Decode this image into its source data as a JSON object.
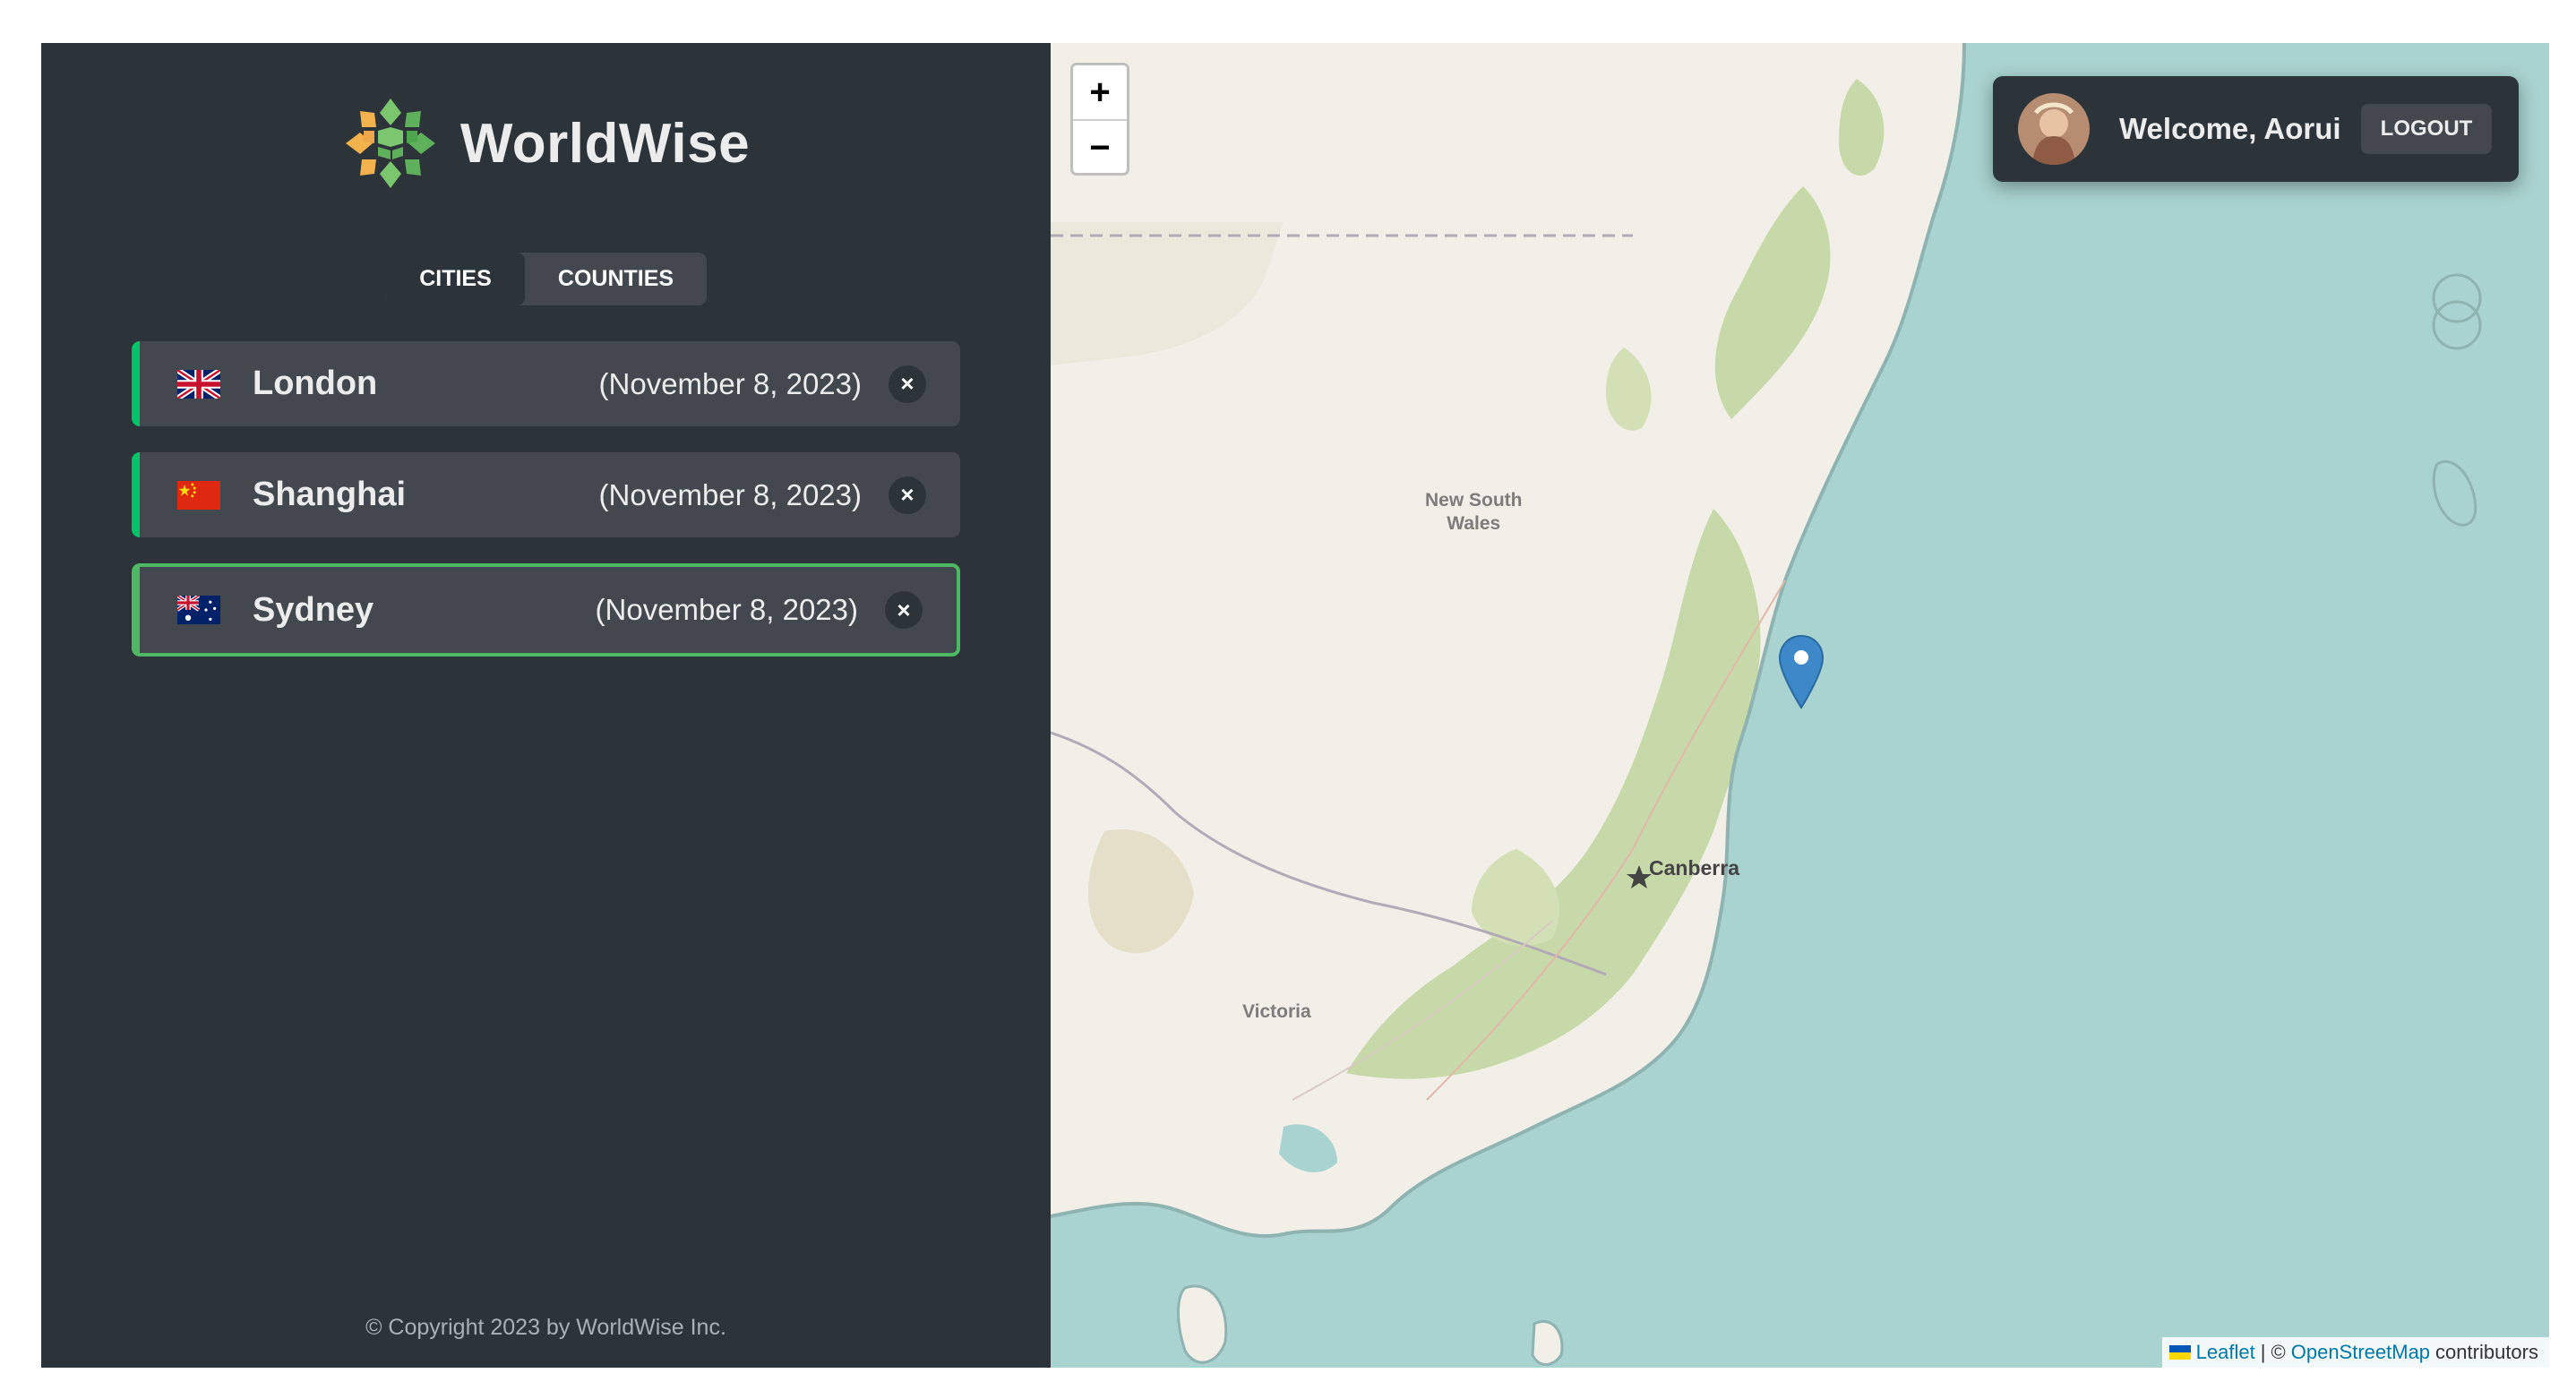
{
  "app": {
    "name": "WorldWise"
  },
  "tabs": [
    {
      "label": "CITIES",
      "active": true
    },
    {
      "label": "COUNTIES",
      "active": false
    }
  ],
  "cities": [
    {
      "name": "London",
      "date": "(November 8, 2023)",
      "flag": "uk-flag",
      "selected": false
    },
    {
      "name": "Shanghai",
      "date": "(November 8, 2023)",
      "flag": "china-flag",
      "selected": false
    },
    {
      "name": "Sydney",
      "date": "(November 8, 2023)",
      "flag": "australia-flag",
      "selected": true
    }
  ],
  "delete_label": "×",
  "footer": "© Copyright 2023 by WorldWise Inc.",
  "map": {
    "zoom_in": "+",
    "zoom_out": "−",
    "labels": {
      "nsw": "New South\nWales",
      "canberra": "Canberra",
      "victoria": "Victoria"
    },
    "attribution": {
      "leaflet": "Leaflet",
      "separator": "| ©",
      "osm": "OpenStreetMap",
      "contributors": "contributors"
    }
  },
  "user": {
    "welcome": "Welcome, Aorui",
    "logout": "LOGOUT"
  },
  "colors": {
    "sidebar_bg": "#2d3439",
    "item_bg": "#42484d",
    "accent_green": "#00c46a",
    "selected_border": "#4db964",
    "sea": "#a9d3d0",
    "land": "#f2efe9"
  }
}
